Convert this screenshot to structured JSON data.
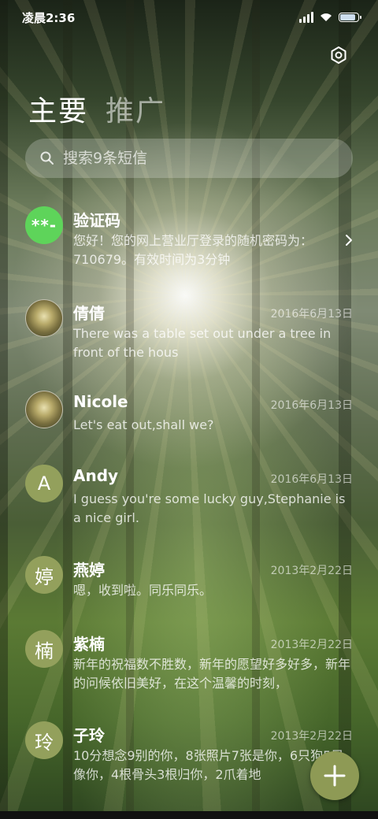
{
  "status": {
    "time": "凌晨2:36",
    "battery_level": 0.85
  },
  "header": {
    "tabs": [
      "主要",
      "推广"
    ],
    "active_tab": "主要"
  },
  "search": {
    "placeholder": "搜索9条短信"
  },
  "icons": {
    "settings": "gear-icon",
    "search": "search-icon",
    "chevron": "chevron-right-icon",
    "fab": "plus-icon"
  },
  "colors": {
    "verify_avatar": "#5ed45a",
    "contact_avatar": "#93a05c",
    "fab": "#8e9a55"
  },
  "conversations": [
    {
      "avatar_text": "**-",
      "name": "验证码",
      "date": "",
      "preview": "您好！您的网上营业厅登录的随机密码为：710679。有效时间为3分钟"
    },
    {
      "avatar_text": "",
      "name": "倩倩",
      "date": "2016年6月13日",
      "preview": "There was a table set out under a tree in front of the hous"
    },
    {
      "avatar_text": "",
      "name": "Nicole",
      "date": "2016年6月13日",
      "preview": "Let's eat out,shall we?"
    },
    {
      "avatar_text": "A",
      "name": "Andy",
      "date": "2016年6月13日",
      "preview": "I guess you're some lucky guy,Stephanie is a nice girl."
    },
    {
      "avatar_text": "婷",
      "name": "燕婷",
      "date": "2013年2月22日",
      "preview": "嗯，收到啦。同乐同乐。"
    },
    {
      "avatar_text": "楠",
      "name": "紫楠",
      "date": "2013年2月22日",
      "preview": "新年的祝福数不胜数，新年的愿望好多好多，新年的问候依旧美好，在这个温馨的时刻，"
    },
    {
      "avatar_text": "玲",
      "name": "子玲",
      "date": "2013年2月22日",
      "preview": "10分想念9别的你，8张照片7张是你，6只狗5只像你，4根骨头3根归你，2爪着地"
    }
  ]
}
